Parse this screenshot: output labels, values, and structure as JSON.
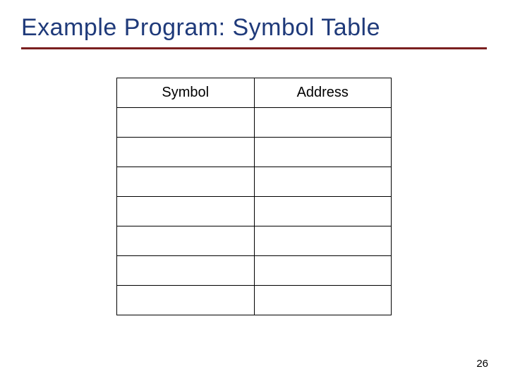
{
  "title": "Example Program: Symbol Table",
  "table": {
    "headers": {
      "symbol": "Symbol",
      "address": "Address"
    },
    "rows": [
      {
        "symbol": "",
        "address": ""
      },
      {
        "symbol": "",
        "address": ""
      },
      {
        "symbol": "",
        "address": ""
      },
      {
        "symbol": "",
        "address": ""
      },
      {
        "symbol": "",
        "address": ""
      },
      {
        "symbol": "",
        "address": ""
      },
      {
        "symbol": "",
        "address": ""
      }
    ]
  },
  "page_number": "26"
}
